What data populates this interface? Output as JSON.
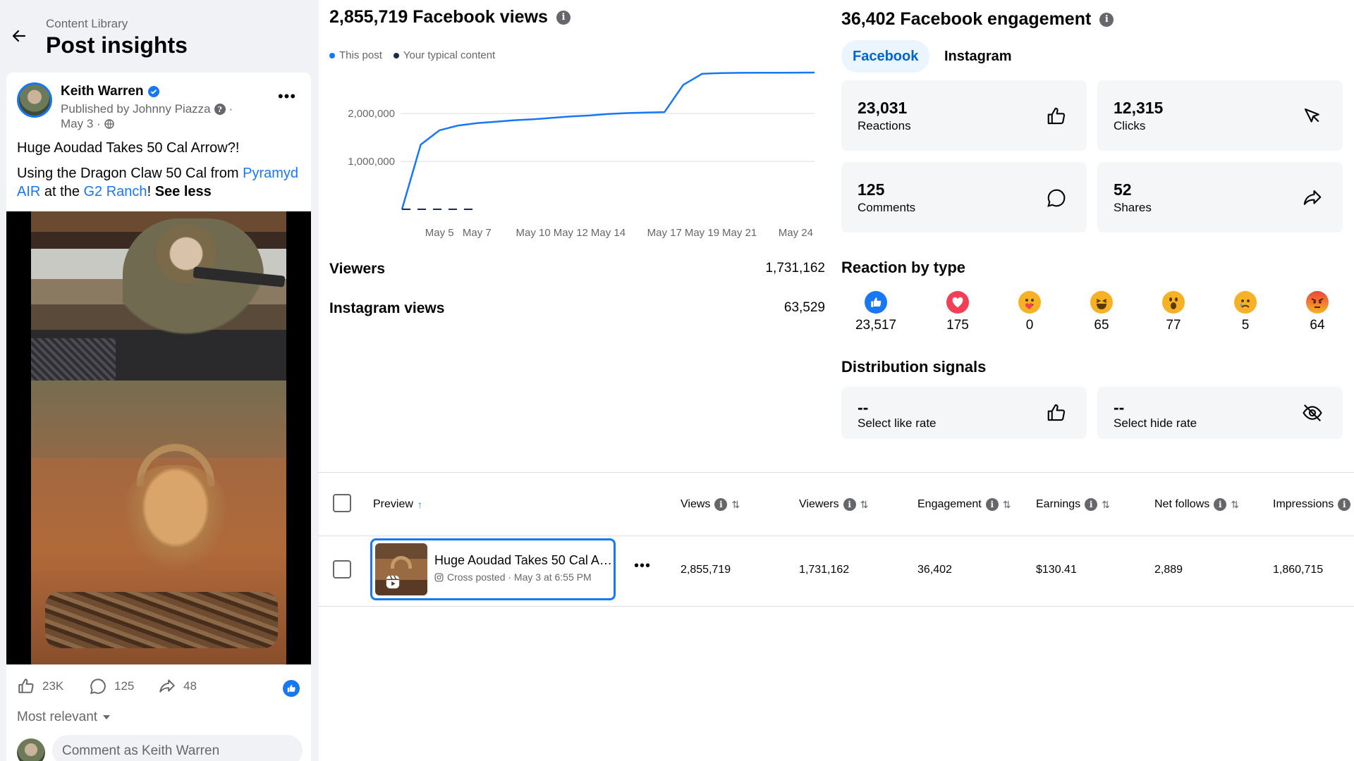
{
  "header": {
    "breadcrumb": "Content Library",
    "title": "Post insights"
  },
  "post": {
    "author": "Keith Warren",
    "published_by": "Published by Johnny Piazza",
    "date": "May 3 ·",
    "title": "Huge Aoudad Takes 50 Cal Arrow?!",
    "desc_1": "Using the Dragon Claw 50 Cal from ",
    "link_1": "Pyramyd AIR",
    "desc_2": " at the ",
    "link_2": "G2 Ranch",
    "desc_3": "! ",
    "see_less": "See less",
    "likes": "23K",
    "comments": "125",
    "shares": "48",
    "sort_label": "Most relevant",
    "comment_placeholder": "Comment as Keith Warren"
  },
  "views": {
    "title": "2,855,719 Facebook views",
    "legend_this": "This post",
    "legend_typical": "Your typical content",
    "viewers_label": "Viewers",
    "viewers_value": "1,731,162",
    "ig_label": "Instagram views",
    "ig_value": "63,529"
  },
  "chart_data": {
    "type": "line",
    "x": [
      "May 3",
      "May 4",
      "May 5",
      "May 6",
      "May 7",
      "May 8",
      "May 9",
      "May 10",
      "May 11",
      "May 12",
      "May 13",
      "May 14",
      "May 15",
      "May 16",
      "May 17",
      "May 18",
      "May 19",
      "May 20",
      "May 21",
      "May 22",
      "May 23",
      "May 24",
      "May 25"
    ],
    "xtick_labels": [
      "May 5",
      "May 7",
      "May 10",
      "May 12",
      "May 14",
      "May 17",
      "May 19",
      "May 21",
      "May 24"
    ],
    "ytick_labels": [
      "1,000,000",
      "2,000,000"
    ],
    "ylim": [
      0,
      2900000
    ],
    "series": [
      {
        "name": "This post",
        "color": "#1877f2",
        "style": "solid",
        "values": [
          0,
          1350000,
          1650000,
          1750000,
          1800000,
          1830000,
          1860000,
          1880000,
          1910000,
          1940000,
          1960000,
          1990000,
          2010000,
          2020000,
          2030000,
          2600000,
          2830000,
          2845000,
          2850000,
          2852000,
          2853000,
          2855000,
          2855719
        ]
      },
      {
        "name": "Your typical content",
        "color": "#1c2b4a",
        "style": "dashed",
        "values": [
          0,
          0,
          0,
          0,
          0
        ]
      }
    ]
  },
  "engagement": {
    "title": "36,402 Facebook engagement",
    "tab_facebook": "Facebook",
    "tab_instagram": "Instagram",
    "reactions_num": "23,031",
    "reactions_lbl": "Reactions",
    "clicks_num": "12,315",
    "clicks_lbl": "Clicks",
    "comments_num": "125",
    "comments_lbl": "Comments",
    "shares_num": "52",
    "shares_lbl": "Shares",
    "reaction_title": "Reaction by type",
    "reactions": [
      {
        "icon": "like-icon",
        "count": "23,517"
      },
      {
        "icon": "love-icon",
        "count": "175"
      },
      {
        "icon": "care-icon",
        "count": "0"
      },
      {
        "icon": "haha-icon",
        "count": "65"
      },
      {
        "icon": "wow-icon",
        "count": "77"
      },
      {
        "icon": "sad-icon",
        "count": "5"
      },
      {
        "icon": "angry-icon",
        "count": "64"
      }
    ],
    "dist_title": "Distribution signals",
    "like_rate_num": "--",
    "like_rate_lbl": "Select like rate",
    "hide_rate_num": "--",
    "hide_rate_lbl": "Select hide rate"
  },
  "table": {
    "headers": [
      "Preview",
      "Views",
      "Viewers",
      "Engagement",
      "Earnings",
      "Net follows",
      "Impressions"
    ],
    "row": {
      "title": "Huge Aoudad Takes 50 Cal Arrow?!",
      "subtitle": "Cross posted · May 3 at 6:55 PM",
      "views": "2,855,719",
      "viewers": "1,731,162",
      "engagement": "36,402",
      "earnings": "$130.41",
      "net_follows": "2,889",
      "impressions": "1,860,715"
    }
  },
  "colors": {
    "accent": "#1877f2",
    "tab_bg": "#ebf5ff",
    "card_bg": "#f5f6f7"
  }
}
